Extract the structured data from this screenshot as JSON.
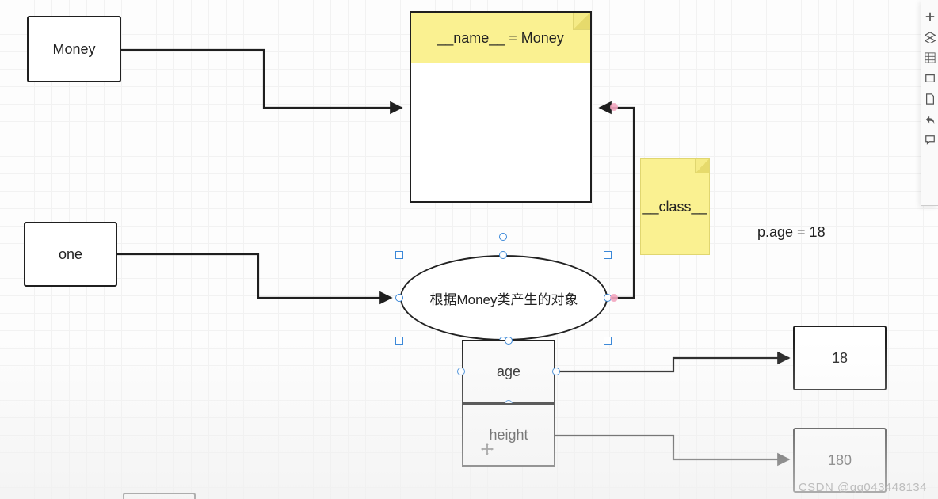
{
  "nodes": {
    "money": {
      "label": "Money"
    },
    "one": {
      "label": "one"
    },
    "class": {
      "header": "__name__ = Money"
    },
    "noteClass": {
      "label": "__class__"
    },
    "ellipse": {
      "label": "根据Money类产生的对象"
    },
    "age": {
      "label": "age"
    },
    "height": {
      "label": "height"
    },
    "val18": {
      "label": "18"
    },
    "val180": {
      "label": "180"
    }
  },
  "labels": {
    "expression": "p.age = 18"
  },
  "watermark": "CSDN @qq043448134",
  "edges": [
    {
      "from": "money",
      "to": "class"
    },
    {
      "from": "one",
      "to": "ellipse"
    },
    {
      "from": "ellipse",
      "to": "class",
      "via_note": "noteClass"
    },
    {
      "from": "age",
      "to": "val18"
    },
    {
      "from": "height",
      "to": "val180"
    }
  ]
}
